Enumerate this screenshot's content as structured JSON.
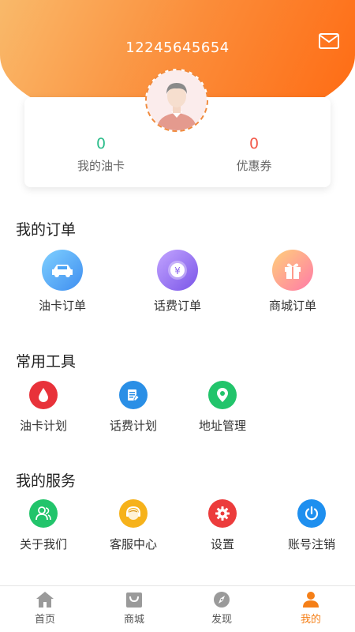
{
  "header": {
    "phone": "12245645654",
    "mail_icon": "mail-icon"
  },
  "stats": {
    "oilcard": {
      "value": "0",
      "label": "我的油卡"
    },
    "coupon": {
      "value": "0",
      "label": "优惠券"
    }
  },
  "orders": {
    "title": "我的订单",
    "items": [
      {
        "label": "油卡订单",
        "icon": "car-icon"
      },
      {
        "label": "话费订单",
        "icon": "yuan-coin-icon"
      },
      {
        "label": "商城订单",
        "icon": "gift-icon"
      }
    ]
  },
  "tools": {
    "title": "常用工具",
    "items": [
      {
        "label": "油卡计划",
        "icon": "oil-drop-icon"
      },
      {
        "label": "话费计划",
        "icon": "note-edit-icon"
      },
      {
        "label": "地址管理",
        "icon": "location-pin-icon"
      }
    ]
  },
  "services": {
    "title": "我的服务",
    "items": [
      {
        "label": "关于我们",
        "icon": "users-icon"
      },
      {
        "label": "客服中心",
        "icon": "customer-service-icon"
      },
      {
        "label": "设置",
        "icon": "gear-icon"
      },
      {
        "label": "账号注销",
        "icon": "power-icon"
      }
    ]
  },
  "tabbar": {
    "items": [
      {
        "label": "首页",
        "icon": "home-icon",
        "active": false
      },
      {
        "label": "商城",
        "icon": "shopping-bag-icon",
        "active": false
      },
      {
        "label": "发现",
        "icon": "compass-icon",
        "active": false
      },
      {
        "label": "我的",
        "icon": "person-icon",
        "active": true
      }
    ]
  },
  "colors": {
    "accent": "#f57f17",
    "green": "#2dbd8b",
    "red": "#f25a4a"
  }
}
